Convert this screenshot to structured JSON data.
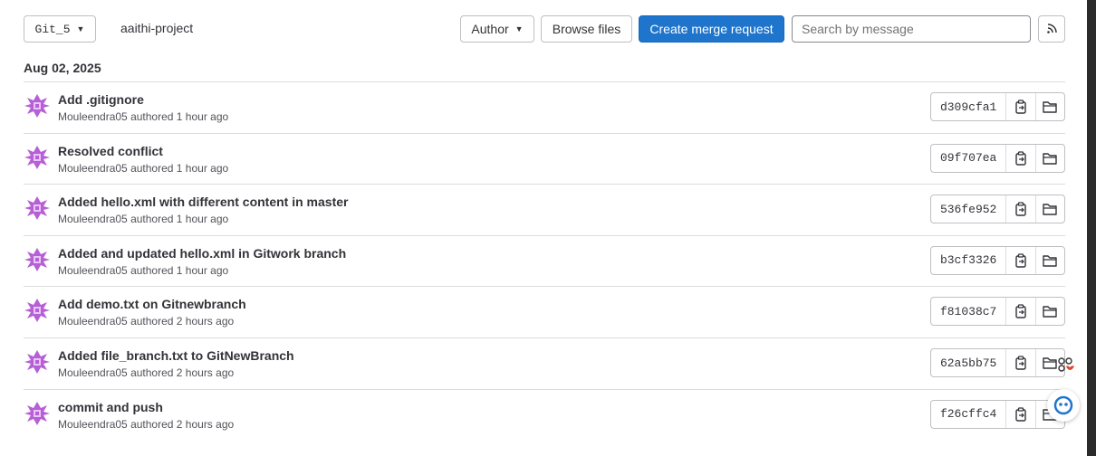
{
  "toolbar": {
    "branch": "Git_5",
    "project": "aaithi-project",
    "author_label": "Author",
    "browse_label": "Browse files",
    "merge_label": "Create merge request",
    "search_placeholder": "Search by message"
  },
  "date_group": "Aug 02, 2025",
  "commits": [
    {
      "title": "Add .gitignore",
      "author": "Mouleendra05",
      "when": "authored 1 hour ago",
      "sha": "d309cfa1"
    },
    {
      "title": "Resolved conflict",
      "author": "Mouleendra05",
      "when": "authored 1 hour ago",
      "sha": "09f707ea"
    },
    {
      "title": "Added hello.xml with different content in master",
      "author": "Mouleendra05",
      "when": "authored 1 hour ago",
      "sha": "536fe952"
    },
    {
      "title": "Added and updated hello.xml in Gitwork branch",
      "author": "Mouleendra05",
      "when": "authored 1 hour ago",
      "sha": "b3cf3326"
    },
    {
      "title": "Add demo.txt on Gitnewbranch",
      "author": "Mouleendra05",
      "when": "authored 2 hours ago",
      "sha": "f81038c7"
    },
    {
      "title": "Added file_branch.txt to GitNewBranch",
      "author": "Mouleendra05",
      "when": "authored 2 hours ago",
      "sha": "62a5bb75"
    },
    {
      "title": "commit and push",
      "author": "Mouleendra05",
      "when": "authored 2 hours ago",
      "sha": "f26cffc4"
    }
  ],
  "colors": {
    "primary": "#1f75cb",
    "avatar": "#b65fd6"
  },
  "icons": {
    "copy": "copy-icon",
    "folder": "folder-icon",
    "rss": "rss-icon",
    "chevron": "chevron-down-icon"
  }
}
